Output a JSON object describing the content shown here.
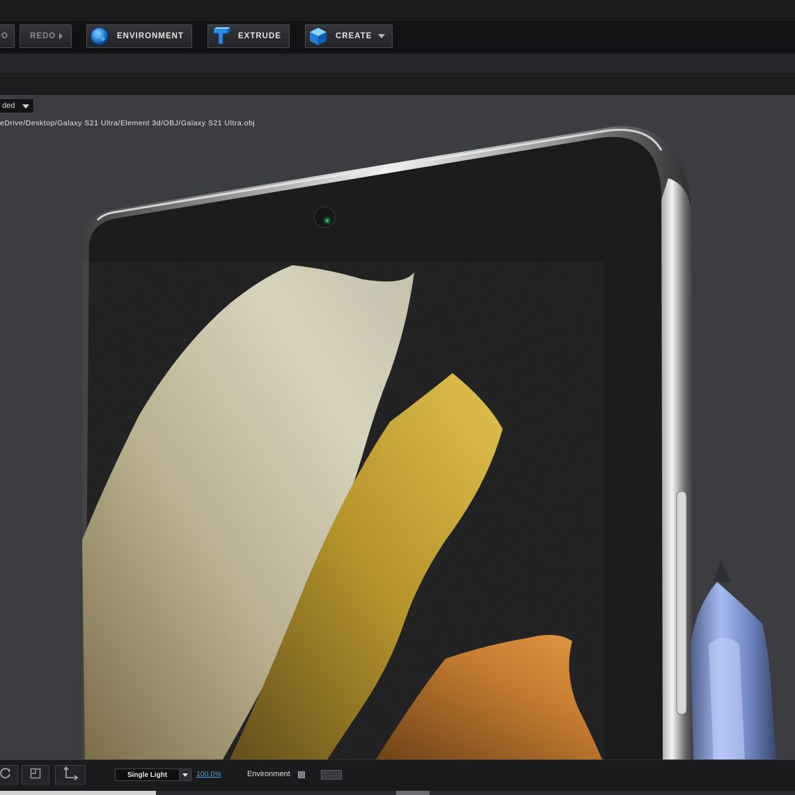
{
  "toolbar": {
    "undo_label": "O",
    "redo_label": "REDO",
    "environment_label": "ENVIRONMENT",
    "extrude_label": "EXTRUDE",
    "create_label": "CREATE"
  },
  "viewport": {
    "shading_mode": "ded",
    "file_path": "eDrive/Desktop/Galaxy S21 Ultra/Element 3d/OBJ/Galaxy S21 Ultra.obj"
  },
  "statusbar": {
    "lighting_mode": "Single Light",
    "zoom_level": "100.0%",
    "environment_label": "Environment",
    "environment_checked": false
  },
  "colors": {
    "accent_blue": "#4fa3e0",
    "viewport_bg": "#3c3d40",
    "toolbar_bg": "#111213"
  },
  "icons": {
    "environment": "globe-icon",
    "extrude": "extrude-t-icon",
    "create": "cube-icon",
    "rotate": "rotate-icon",
    "frame": "frame-icon",
    "axis": "axis-icon"
  },
  "bottom_scrollbar": {
    "visible": true
  }
}
